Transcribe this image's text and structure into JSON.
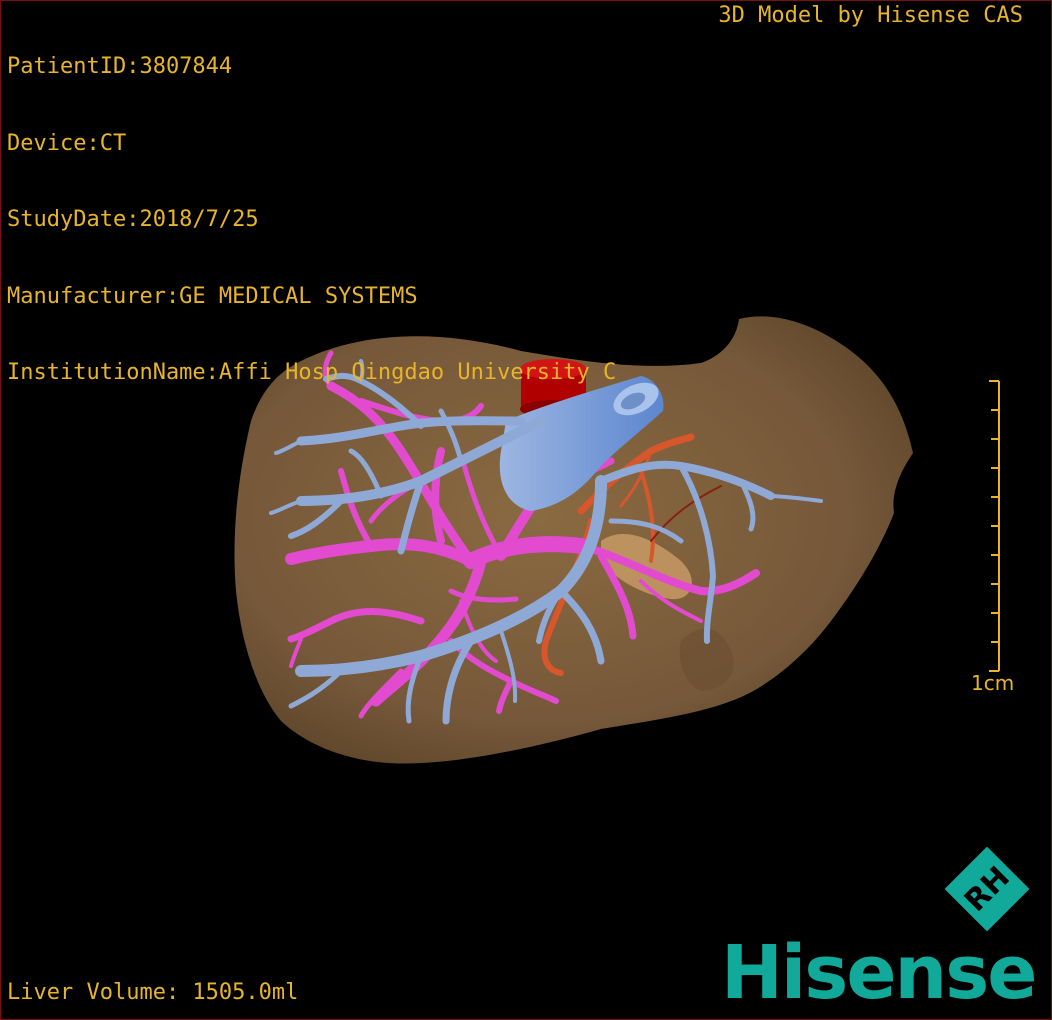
{
  "overlay": {
    "patient_id": "PatientID:3807844",
    "device": "Device:CT",
    "study_date": "StudyDate:2018/7/25",
    "manufacturer": "Manufacturer:GE MEDICAL SYSTEMS",
    "institution": "InstitutionName:Affi Hosp Qingdao University C",
    "credit": "3D Model by Hisense CAS",
    "volume": "Liver Volume: 1505.0ml"
  },
  "scale_bar": {
    "label": "1cm"
  },
  "brand": {
    "name": "Hisense",
    "mark_text": "RH"
  },
  "colors": {
    "overlay_text": "#e8b52a",
    "liver": "#7a5c36",
    "portal_vein": "#e24bd0",
    "hepatic_vein": "#8fa9d6",
    "vena_cava": "#6f98d8",
    "aorta": "#b00000",
    "hepatic_artery": "#d8562c",
    "brand": "#10a99a"
  }
}
